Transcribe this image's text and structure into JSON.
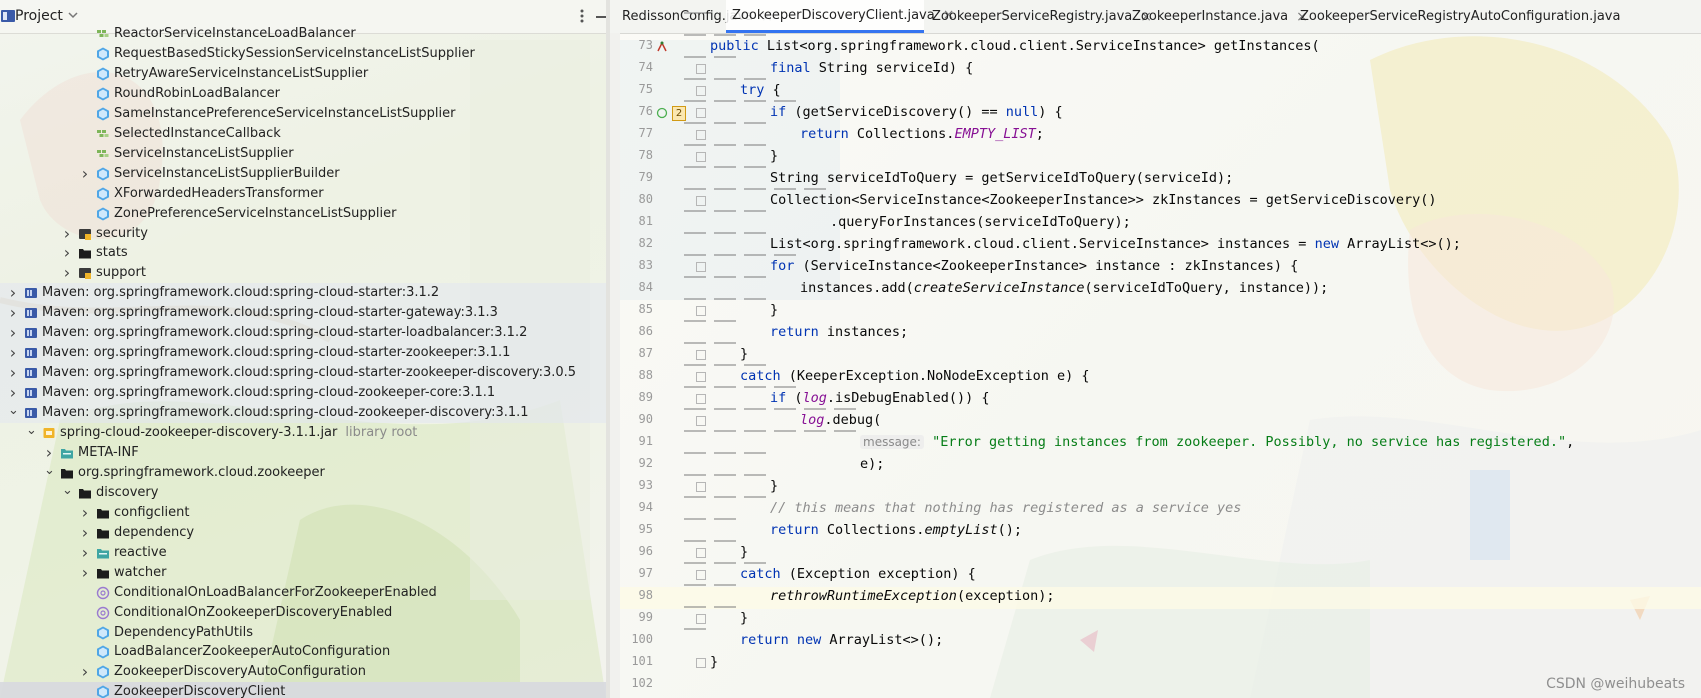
{
  "project_panel": {
    "title": "Project",
    "tree": [
      {
        "label": "ReactorServiceInstanceLoadBalancer",
        "icon": "interface-icon",
        "depth": 5,
        "arrow": ""
      },
      {
        "label": "RequestBasedStickySessionServiceInstanceListSupplier",
        "icon": "class-icon",
        "depth": 5,
        "arrow": ""
      },
      {
        "label": "RetryAwareServiceInstanceListSupplier",
        "icon": "class-icon",
        "depth": 5,
        "arrow": ""
      },
      {
        "label": "RoundRobinLoadBalancer",
        "icon": "class-icon",
        "depth": 5,
        "arrow": ""
      },
      {
        "label": "SameInstancePreferenceServiceInstanceListSupplier",
        "icon": "class-icon",
        "depth": 5,
        "arrow": ""
      },
      {
        "label": "SelectedInstanceCallback",
        "icon": "interface-icon",
        "depth": 5,
        "arrow": ""
      },
      {
        "label": "ServiceInstanceListSupplier",
        "icon": "interface-icon",
        "depth": 5,
        "arrow": ""
      },
      {
        "label": "ServiceInstanceListSupplierBuilder",
        "icon": "class-icon",
        "depth": 5,
        "arrow": "right"
      },
      {
        "label": "XForwardedHeadersTransformer",
        "icon": "class-icon",
        "depth": 5,
        "arrow": ""
      },
      {
        "label": "ZonePreferenceServiceInstanceListSupplier",
        "icon": "class-icon",
        "depth": 5,
        "arrow": ""
      },
      {
        "label": "security",
        "icon": "package-icon",
        "depth": 4,
        "arrow": "right"
      },
      {
        "label": "stats",
        "icon": "folder-icon",
        "depth": 4,
        "arrow": "right"
      },
      {
        "label": "support",
        "icon": "package-icon",
        "depth": 4,
        "arrow": "right"
      },
      {
        "label": "Maven: org.springframework.cloud:spring-cloud-starter:3.1.2",
        "icon": "library-icon",
        "depth": 1,
        "arrow": "right",
        "maven": true
      },
      {
        "label": "Maven: org.springframework.cloud:spring-cloud-starter-gateway:3.1.3",
        "icon": "library-icon",
        "depth": 1,
        "arrow": "right",
        "maven": true
      },
      {
        "label": "Maven: org.springframework.cloud:spring-cloud-starter-loadbalancer:3.1.2",
        "icon": "library-icon",
        "depth": 1,
        "arrow": "right",
        "maven": true
      },
      {
        "label": "Maven: org.springframework.cloud:spring-cloud-starter-zookeeper:3.1.1",
        "icon": "library-icon",
        "depth": 1,
        "arrow": "right",
        "maven": true
      },
      {
        "label": "Maven: org.springframework.cloud:spring-cloud-starter-zookeeper-discovery:3.0.5",
        "icon": "library-icon",
        "depth": 1,
        "arrow": "right",
        "maven": true
      },
      {
        "label": "Maven: org.springframework.cloud:spring-cloud-zookeeper-core:3.1.1",
        "icon": "library-icon",
        "depth": 1,
        "arrow": "right",
        "maven": true
      },
      {
        "label": "Maven: org.springframework.cloud:spring-cloud-zookeeper-discovery:3.1.1",
        "icon": "library-icon",
        "depth": 1,
        "arrow": "down",
        "maven": true
      },
      {
        "label": "spring-cloud-zookeeper-discovery-3.1.1.jar",
        "note": "library root",
        "icon": "jar-icon",
        "depth": 2,
        "arrow": "down"
      },
      {
        "label": "META-INF",
        "icon": "meta-folder-icon",
        "depth": 3,
        "arrow": "right"
      },
      {
        "label": "org.springframework.cloud.zookeeper",
        "icon": "folder-icon",
        "depth": 3,
        "arrow": "down"
      },
      {
        "label": "discovery",
        "icon": "folder-icon",
        "depth": 4,
        "arrow": "down"
      },
      {
        "label": "configclient",
        "icon": "folder-icon",
        "depth": 5,
        "arrow": "right"
      },
      {
        "label": "dependency",
        "icon": "folder-icon",
        "depth": 5,
        "arrow": "right"
      },
      {
        "label": "reactive",
        "icon": "meta-folder-icon",
        "depth": 5,
        "arrow": "right"
      },
      {
        "label": "watcher",
        "icon": "folder-icon",
        "depth": 5,
        "arrow": "right"
      },
      {
        "label": "ConditionalOnLoadBalancerForZookeeperEnabled",
        "icon": "annotation-icon",
        "depth": 5,
        "arrow": ""
      },
      {
        "label": "ConditionalOnZookeeperDiscoveryEnabled",
        "icon": "annotation-icon",
        "depth": 5,
        "arrow": ""
      },
      {
        "label": "DependencyPathUtils",
        "icon": "class-icon",
        "depth": 5,
        "arrow": ""
      },
      {
        "label": "LoadBalancerZookeeperAutoConfiguration",
        "icon": "class-icon",
        "depth": 5,
        "arrow": ""
      },
      {
        "label": "ZookeeperDiscoveryAutoConfiguration",
        "icon": "class-icon",
        "depth": 5,
        "arrow": "right"
      },
      {
        "label": "ZookeeperDiscoveryClient",
        "icon": "class-icon",
        "depth": 5,
        "arrow": "",
        "selected": true
      }
    ]
  },
  "tabs": [
    {
      "label": "RedissonConfig.java",
      "icon": "java-file-icon",
      "active": false
    },
    {
      "label": "ZookeeperDiscoveryClient.java",
      "icon": "class-icon",
      "active": true
    },
    {
      "label": "ZookeeperServiceRegistry.java",
      "icon": "class-icon",
      "active": false
    },
    {
      "label": "ZookeeperInstance.java",
      "icon": "class-icon",
      "active": false
    },
    {
      "label": "ZookeeperServiceRegistryAutoConfiguration.java",
      "icon": "class-icon",
      "active": false
    }
  ],
  "gutter_badge": "2",
  "code": {
    "line_numbers": [
      "73",
      "74",
      "75",
      "76",
      "77",
      "78",
      "79",
      "80",
      "81",
      "82",
      "83",
      "84",
      "85",
      "86",
      "87",
      "88",
      "89",
      "90",
      "91",
      "92",
      "93",
      "94",
      "95",
      "96",
      "97",
      "98",
      "99",
      "100",
      "101",
      "102"
    ],
    "lines": [
      [
        [
          "kw",
          "public "
        ],
        [
          "",
          "List<org.springframework.cloud.client.ServiceInstance> getInstances("
        ]
      ],
      [
        [
          "kw",
          "final "
        ],
        [
          "",
          "String serviceId) {"
        ]
      ],
      [
        [
          "kw",
          "try "
        ],
        [
          "",
          "{"
        ]
      ],
      [
        [
          "kw",
          "if "
        ],
        [
          "",
          "(getServiceDiscovery() == "
        ],
        [
          "kw",
          "null"
        ],
        [
          "",
          ") {"
        ]
      ],
      [
        [
          "kw",
          "return "
        ],
        [
          "",
          "Collections."
        ],
        [
          "fld",
          "EMPTY_LIST"
        ],
        [
          "",
          ";"
        ]
      ],
      [
        [
          "",
          "}"
        ]
      ],
      [
        [
          "",
          "String serviceIdToQuery = getServiceIdToQuery(serviceId);"
        ]
      ],
      [
        [
          "",
          "Collection<ServiceInstance<ZookeeperInstance>> zkInstances = getServiceDiscovery()"
        ]
      ],
      [
        [
          "",
          ".queryForInstances(serviceIdToQuery);"
        ]
      ],
      [
        [
          "",
          "List<org.springframework.cloud.client.ServiceInstance> instances = "
        ],
        [
          "kw",
          "new "
        ],
        [
          "",
          "ArrayList<>();"
        ]
      ],
      [
        [
          "kw",
          "for "
        ],
        [
          "",
          "(ServiceInstance<ZookeeperInstance> instance : zkInstances) {"
        ]
      ],
      [
        [
          "",
          "instances.add("
        ],
        [
          "st",
          "createServiceInstance"
        ],
        [
          "",
          "(serviceIdToQuery, instance));"
        ]
      ],
      [
        [
          "",
          "}"
        ]
      ],
      [
        [
          "kw",
          "return "
        ],
        [
          "",
          "instances;"
        ]
      ],
      [
        [
          "",
          "}"
        ]
      ],
      [
        [
          "kw",
          "catch "
        ],
        [
          "",
          "(KeeperException.NoNodeException e) {"
        ]
      ],
      [
        [
          "kw",
          "if "
        ],
        [
          "",
          "("
        ],
        [
          "fld",
          "log"
        ],
        [
          "",
          ".isDebugEnabled()) {"
        ]
      ],
      [
        [
          "fld",
          "log"
        ],
        [
          "",
          ".debug("
        ]
      ],
      [
        [
          "hint",
          "message:"
        ],
        [
          "",
          ""
        ],
        [
          "str",
          " \"Error getting instances from zookeeper. Possibly, no service has registered.\""
        ],
        [
          "",
          ","
        ]
      ],
      [
        [
          "",
          "e);"
        ]
      ],
      [
        [
          "",
          "}"
        ]
      ],
      [
        [
          "cmt",
          "// this means that nothing has registered as a service yes"
        ]
      ],
      [
        [
          "kw",
          "return "
        ],
        [
          "",
          "Collections."
        ],
        [
          "st",
          "emptyList"
        ],
        [
          "",
          "();"
        ]
      ],
      [
        [
          "",
          "}"
        ]
      ],
      [
        [
          "kw",
          "catch "
        ],
        [
          "",
          "(Exception exception) {"
        ]
      ],
      [
        [
          "st",
          "rethrowRuntimeException"
        ],
        [
          "",
          "(exception);"
        ]
      ],
      [
        [
          "",
          "}"
        ]
      ],
      [
        [
          "kw",
          "return new "
        ],
        [
          "",
          "ArrayList<>();"
        ]
      ],
      [
        [
          "",
          "}"
        ]
      ],
      [
        [
          "",
          ""
        ]
      ]
    ],
    "indents": [
      1,
      3,
      2,
      3,
      4,
      3,
      3,
      3,
      5,
      3,
      3,
      4,
      3,
      3,
      2,
      2,
      3,
      4,
      6,
      6,
      3,
      3,
      3,
      2,
      2,
      3,
      2,
      2,
      1,
      0
    ]
  },
  "watermark": "CSDN @weihubeats",
  "colors": {
    "accent": "#3574f0",
    "keyword": "#0033b3",
    "string": "#067d17",
    "field": "#871094",
    "comment": "#8c8c8c"
  }
}
